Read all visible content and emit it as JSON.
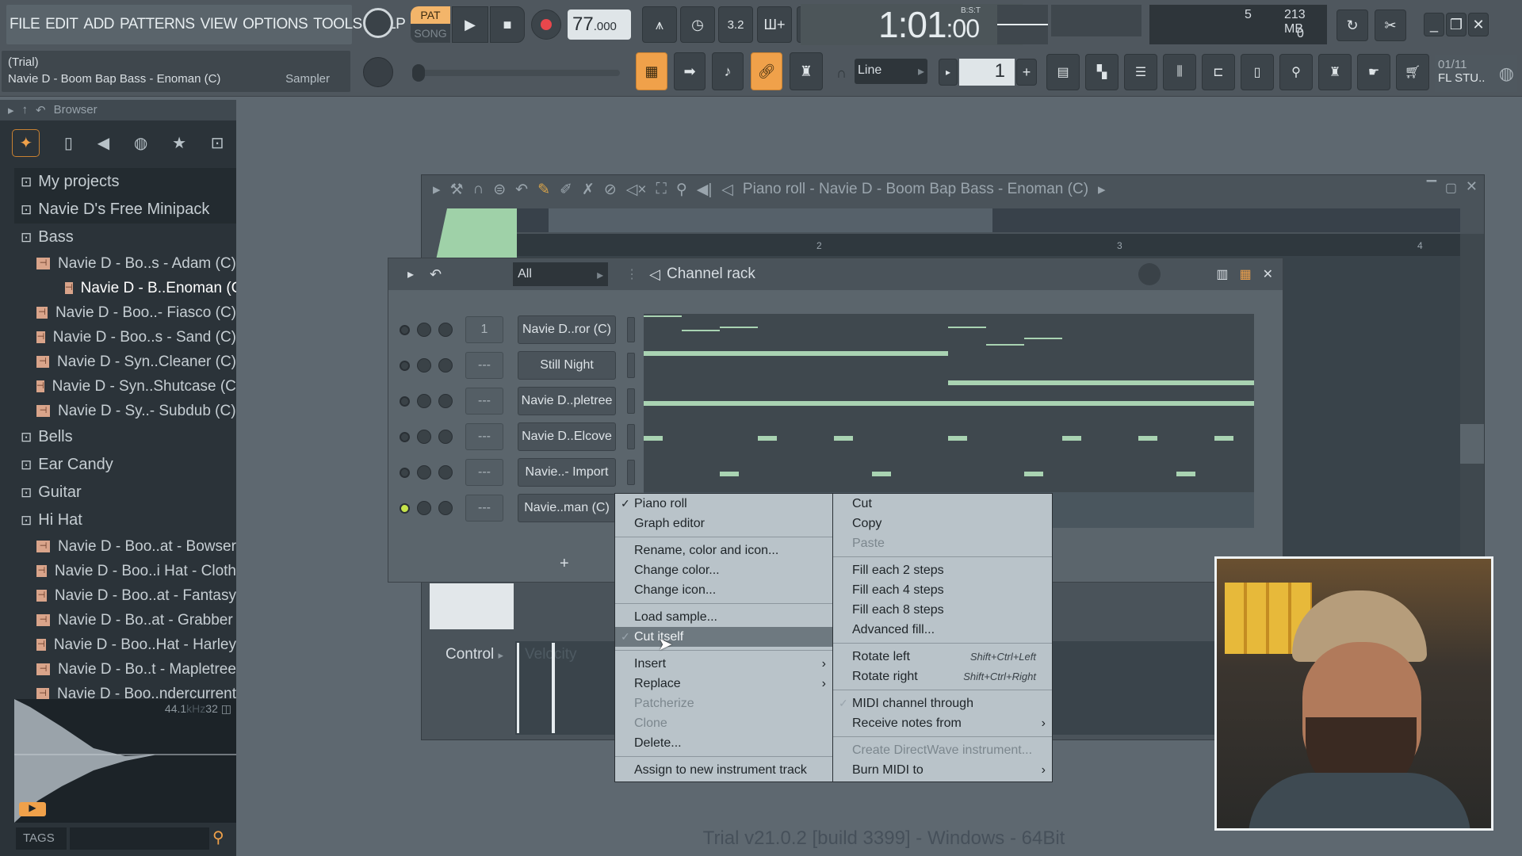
{
  "menu": [
    "FILE",
    "EDIT",
    "ADD",
    "PATTERNS",
    "VIEW",
    "OPTIONS",
    "TOOLS",
    "HELP"
  ],
  "hint": {
    "line1": "(Trial)",
    "line2": "Navie D - Boom Bap Bass - Enoman (C)",
    "plugin": "Sampler"
  },
  "transport": {
    "pat": "PAT",
    "song": "SONG",
    "tempo": "77",
    "tempo_dec": ".000",
    "time": "1:01",
    "time_sub": ":00",
    "time_label": "B:S:T",
    "cpu": "5",
    "memory": "213 MB",
    "polyphony": "0",
    "snap": "Line",
    "pattern": "1",
    "news": "01/11",
    "news_sub": "FL STU.."
  },
  "accent": "#f0a14a",
  "browser": {
    "title": "Browser",
    "items": [
      {
        "type": "folder",
        "label": "My projects",
        "level": 0
      },
      {
        "type": "folder",
        "label": "Navie D's Free Minipack",
        "level": 0
      },
      {
        "type": "folder",
        "label": "Bass",
        "level": 1
      },
      {
        "type": "file",
        "label": "Navie D - Bo..s - Adam (C)",
        "level": 2
      },
      {
        "type": "file",
        "label": "Navie D - B..Enoman (C)",
        "level": 3,
        "selected": true
      },
      {
        "type": "file",
        "label": "Navie D - Boo..- Fiasco (C)",
        "level": 2
      },
      {
        "type": "file",
        "label": "Navie D - Boo..s - Sand (C)",
        "level": 2
      },
      {
        "type": "file",
        "label": "Navie D - Syn..Cleaner (C)",
        "level": 2
      },
      {
        "type": "file",
        "label": "Navie D - Syn..Shutcase (C)",
        "level": 2
      },
      {
        "type": "file",
        "label": "Navie D - Sy..- Subdub (C)",
        "level": 2
      },
      {
        "type": "folder",
        "label": "Bells",
        "level": 1
      },
      {
        "type": "folder",
        "label": "Ear Candy",
        "level": 1
      },
      {
        "type": "folder",
        "label": "Guitar",
        "level": 1
      },
      {
        "type": "folder",
        "label": "Hi Hat",
        "level": 1
      },
      {
        "type": "file",
        "label": "Navie D - Boo..at - Bowser",
        "level": 2
      },
      {
        "type": "file",
        "label": "Navie D - Boo..i Hat - Cloth",
        "level": 2
      },
      {
        "type": "file",
        "label": "Navie D - Boo..at - Fantasy",
        "level": 2
      },
      {
        "type": "file",
        "label": "Navie D - Bo..at - Grabber",
        "level": 2
      },
      {
        "type": "file",
        "label": "Navie D - Boo..Hat - Harley",
        "level": 2
      },
      {
        "type": "file",
        "label": "Navie D - Bo..t - Mapletree",
        "level": 2
      },
      {
        "type": "file",
        "label": "Navie D - Boo..ndercurrent",
        "level": 2
      }
    ],
    "sample_rate": "44.1",
    "sample_unit": "kHz",
    "bits": "32",
    "tags": "TAGS"
  },
  "piano_roll": {
    "title": "Piano roll - Navie D - Boom Bap Bass - Enoman (C)",
    "bars": [
      "2",
      "3",
      "4"
    ],
    "control": "Control",
    "velocity": "Velocity"
  },
  "channel_rack": {
    "title": "Channel rack",
    "filter": "All",
    "add": "+",
    "channels": [
      {
        "name": "Navie D..ror (C)",
        "track": "1",
        "active": false
      },
      {
        "name": "Still Night",
        "track": "---",
        "active": false
      },
      {
        "name": "Navie D..pletree",
        "track": "---",
        "active": false
      },
      {
        "name": "Navie D..Elcove",
        "track": "---",
        "active": false
      },
      {
        "name": "Navie..- Import",
        "track": "---",
        "active": false
      },
      {
        "name": "Navie..man (C)",
        "track": "---",
        "active": true
      }
    ]
  },
  "context_menu": {
    "left": [
      {
        "label": "Piano roll",
        "checked": true
      },
      {
        "label": "Graph editor"
      },
      {
        "sep": true
      },
      {
        "label": "Rename, color and icon..."
      },
      {
        "label": "Change color..."
      },
      {
        "label": "Change icon..."
      },
      {
        "sep": true
      },
      {
        "label": "Load sample..."
      },
      {
        "label": "Cut itself",
        "checked": true,
        "highlight": true
      },
      {
        "sep": true
      },
      {
        "label": "Insert",
        "submenu": true
      },
      {
        "label": "Replace",
        "submenu": true
      },
      {
        "label": "Patcherize",
        "disabled": true
      },
      {
        "label": "Clone",
        "disabled": true
      },
      {
        "label": "Delete..."
      },
      {
        "sep": true
      },
      {
        "label": "Assign to new instrument track"
      }
    ],
    "right": [
      {
        "label": "Cut"
      },
      {
        "label": "Copy"
      },
      {
        "label": "Paste",
        "disabled": true
      },
      {
        "sep": true
      },
      {
        "label": "Fill each 2 steps"
      },
      {
        "label": "Fill each 4 steps"
      },
      {
        "label": "Fill each 8 steps"
      },
      {
        "label": "Advanced fill..."
      },
      {
        "sep": true
      },
      {
        "label": "Rotate left",
        "shortcut": "Shift+Ctrl+Left"
      },
      {
        "label": "Rotate right",
        "shortcut": "Shift+Ctrl+Right"
      },
      {
        "sep": true
      },
      {
        "label": "MIDI channel through",
        "checked": true,
        "dim_check": true
      },
      {
        "label": "Receive notes from",
        "submenu": true
      },
      {
        "sep": true
      },
      {
        "label": "Create DirectWave instrument...",
        "disabled": true
      },
      {
        "label": "Burn MIDI to",
        "submenu": true
      }
    ]
  },
  "footer": "Trial v21.0.2 [build 3399] - Windows - 64Bit"
}
